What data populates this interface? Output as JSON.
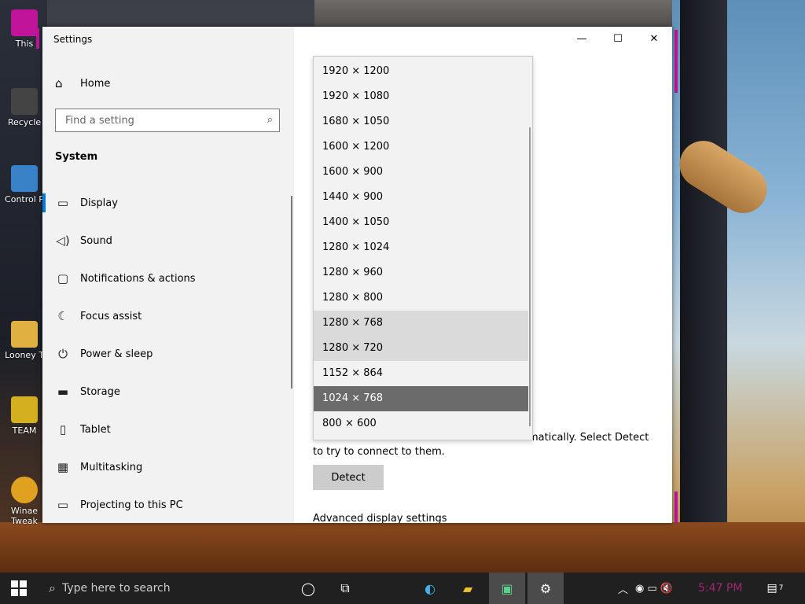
{
  "desktop": {
    "icons": [
      {
        "label": "This",
        "color": "#c0149a"
      },
      {
        "label": "Recycle",
        "color": "#444"
      },
      {
        "label": "Control P",
        "color": "#3a82c8"
      },
      {
        "label": "Looney T",
        "color": "#e0b040"
      },
      {
        "label": "TEAM",
        "color": "#d4b020"
      },
      {
        "label": "Winae Tweak",
        "color": "#e0a020"
      }
    ]
  },
  "window": {
    "title": "Settings",
    "accent_color": "#c0149a",
    "captions": {
      "minimize": "—",
      "maximize": "☐",
      "close": "✕"
    }
  },
  "nav": {
    "home": {
      "label": "Home",
      "icon": "home-icon"
    },
    "search_placeholder": "Find a setting",
    "section_title": "System",
    "items": [
      {
        "label": "Display",
        "icon": "display-icon",
        "glyph": "▭",
        "active": true
      },
      {
        "label": "Sound",
        "icon": "sound-icon",
        "glyph": "🔈"
      },
      {
        "label": "Notifications & actions",
        "icon": "notifications-icon",
        "glyph": "▢"
      },
      {
        "label": "Focus assist",
        "icon": "moon-icon",
        "glyph": "☾"
      },
      {
        "label": "Power & sleep",
        "icon": "power-icon",
        "glyph": "⏻"
      },
      {
        "label": "Storage",
        "icon": "storage-icon",
        "glyph": "▬"
      },
      {
        "label": "Tablet",
        "icon": "tablet-icon",
        "glyph": "▯"
      },
      {
        "label": "Multitasking",
        "icon": "multitasking-icon",
        "glyph": "▦"
      },
      {
        "label": "Projecting to this PC",
        "icon": "projecting-icon",
        "glyph": "▭"
      }
    ]
  },
  "content": {
    "detect_text": "matically. Select Detect",
    "detect_text2": "to try to connect to them.",
    "detect_label": "Detect",
    "advanced_label": "Advanced display settings"
  },
  "resolution_dropdown": {
    "selected": "1024 × 768",
    "options": [
      "1920 × 1200",
      "1920 × 1080",
      "1680 × 1050",
      "1600 × 1200",
      "1600 × 900",
      "1440 × 900",
      "1400 × 1050",
      "1280 × 1024",
      "1280 × 960",
      "1280 × 800",
      "1280 × 768",
      "1280 × 720",
      "1152 × 864",
      "1024 × 768",
      "800 × 600"
    ],
    "hovered": [
      "1280 × 768",
      "1280 × 720"
    ]
  },
  "taskbar": {
    "search_placeholder": "Type here to search",
    "buttons": [
      {
        "name": "cortana-icon",
        "glyph": "◯"
      },
      {
        "name": "task-view-icon",
        "glyph": "⧉"
      },
      {
        "name": "edge-icon",
        "glyph": "◐"
      },
      {
        "name": "file-explorer-icon",
        "glyph": "▰"
      },
      {
        "name": "app-icon",
        "glyph": "▣",
        "active": true
      },
      {
        "name": "settings-icon",
        "glyph": "⚙",
        "active": true
      }
    ],
    "tray": {
      "chevron": "︿",
      "glyphs": "◉ ▭ 🔇"
    },
    "clock": "5:47 PM",
    "notifications_count": "7"
  }
}
